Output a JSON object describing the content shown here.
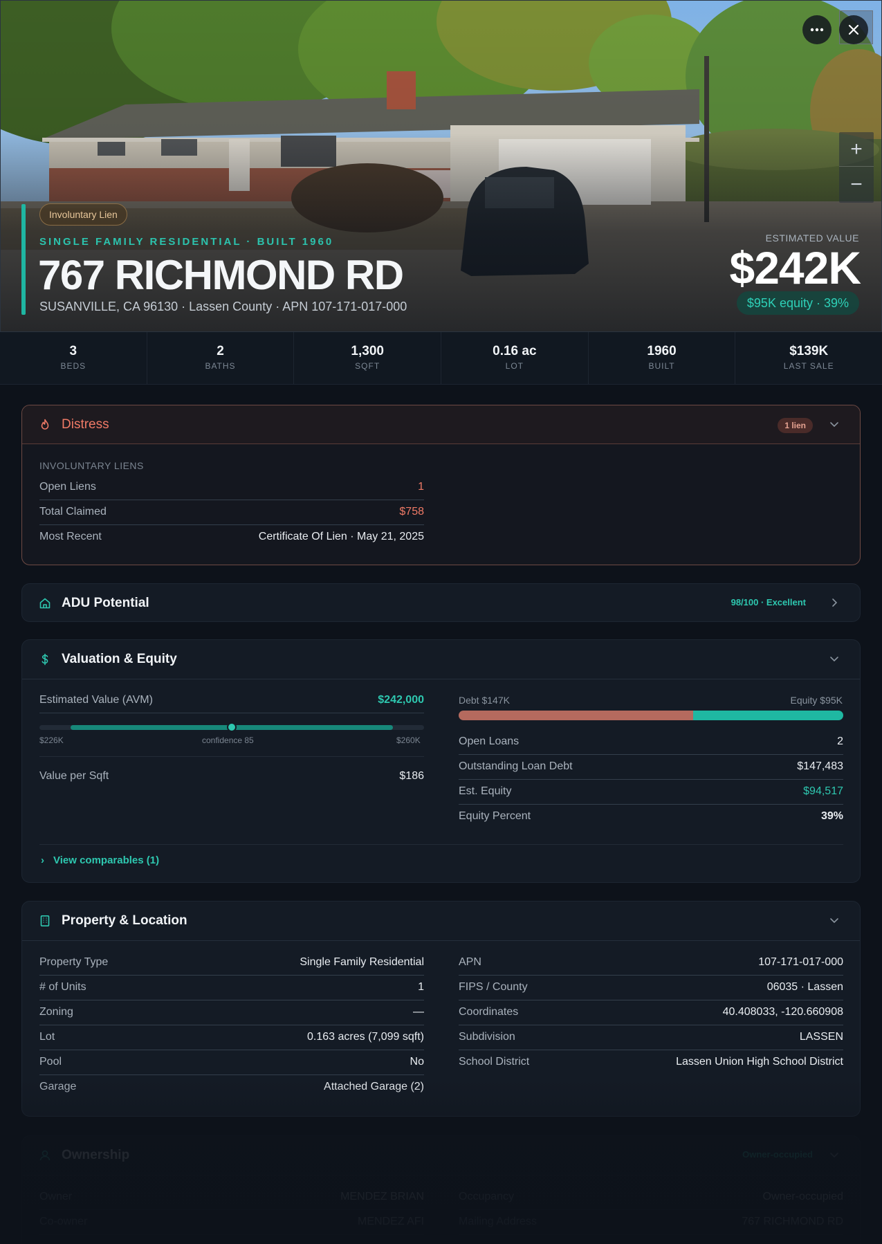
{
  "hero": {
    "tag": "Involuntary Lien",
    "subtitle": "SINGLE FAMILY RESIDENTIAL · BUILT 1960",
    "title": "767 RICHMOND RD",
    "address": "SUSANVILLE, CA 96130 · Lassen County · APN 107-171-017-000",
    "estimated_label": "ESTIMATED VALUE",
    "estimated_value": "$242K",
    "equity_pill": "$95K equity · 39%",
    "buttons": {
      "more": "more-icon",
      "close": "close-icon",
      "zoom_in": "+",
      "zoom_out": "−"
    }
  },
  "stats": [
    {
      "value": "3",
      "label": "BEDS"
    },
    {
      "value": "2",
      "label": "BATHS"
    },
    {
      "value": "1,300",
      "label": "SQFT"
    },
    {
      "value": "0.16 ac",
      "label": "LOT"
    },
    {
      "value": "1960",
      "label": "BUILT"
    },
    {
      "value": "$139K",
      "label": "LAST SALE"
    }
  ],
  "distress": {
    "title": "Distress",
    "badge": "1 lien",
    "section": "INVOLUNTARY LIENS",
    "rows": [
      {
        "k": "Open Liens",
        "v": "1"
      },
      {
        "k": "Total Claimed",
        "v": "$758"
      },
      {
        "k": "Most Recent",
        "v": "Certificate Of Lien · May 21, 2025"
      }
    ]
  },
  "adu": {
    "title": "ADU Potential",
    "score": "98/100 · Excellent"
  },
  "valuation": {
    "title": "Valuation & Equity",
    "avm_label": "Estimated Value (AVM)",
    "avm_value": "$242,000",
    "range_low": "$226K",
    "confidence": "confidence 85",
    "range_high": "$260K",
    "ppsf_label": "Value per Sqft",
    "ppsf_value": "$186",
    "debt_label": "Debt $147K",
    "equity_label": "Equity $95K",
    "debt_fraction": 0.61,
    "rows": [
      {
        "k": "Open Loans",
        "v": "2"
      },
      {
        "k": "Outstanding Loan Debt",
        "v": "$147,483"
      },
      {
        "k": "Est. Equity",
        "v": "$94,517"
      },
      {
        "k": "Equity Percent",
        "v": "39%"
      }
    ],
    "comps": "View comparables (1)"
  },
  "property": {
    "title": "Property & Location",
    "left": [
      {
        "k": "Property Type",
        "v": "Single Family Residential"
      },
      {
        "k": "# of Units",
        "v": "1"
      },
      {
        "k": "Zoning",
        "v": "—"
      },
      {
        "k": "Lot",
        "v": "0.163 acres (7,099 sqft)"
      },
      {
        "k": "Pool",
        "v": "No"
      },
      {
        "k": "Garage",
        "v": "Attached Garage (2)"
      }
    ],
    "right": [
      {
        "k": "APN",
        "v": "107-171-017-000"
      },
      {
        "k": "FIPS / County",
        "v": "06035 · Lassen"
      },
      {
        "k": "Coordinates",
        "v": "40.408033, -120.660908"
      },
      {
        "k": "Subdivision",
        "v": "LASSEN"
      },
      {
        "k": "School District",
        "v": "Lassen Union High School District"
      }
    ]
  },
  "ownership": {
    "title": "Ownership",
    "badge": "Owner-occupied",
    "left": [
      {
        "k": "Owner",
        "v": "MENDEZ BRIAN"
      },
      {
        "k": "Co-owner",
        "v": "MENDEZ AFI"
      }
    ],
    "right": [
      {
        "k": "Occupancy",
        "v": "Owner-occupied"
      },
      {
        "k": "Mailing Address",
        "v": "767 RICHMOND RD"
      }
    ]
  }
}
